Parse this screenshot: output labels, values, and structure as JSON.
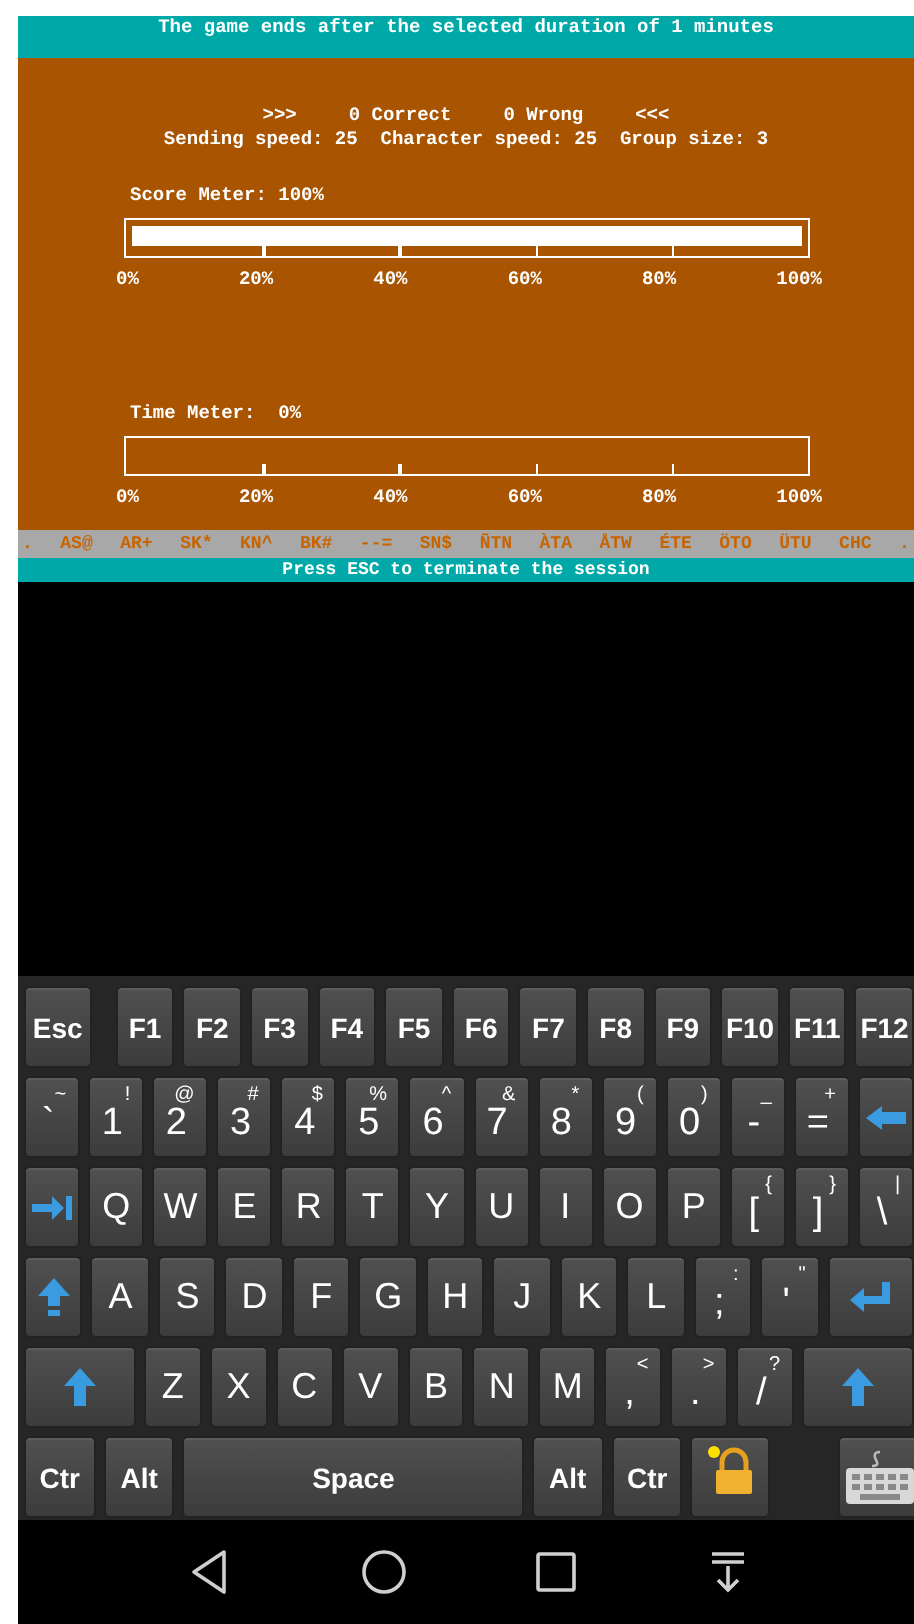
{
  "top_banner": {
    "text": "The game ends after the selected duration of 1 minutes"
  },
  "score_line": {
    "left_marker": ">>>",
    "correct": "0 Correct",
    "wrong": "0 Wrong",
    "right_marker": "<<<"
  },
  "settings_line": {
    "text": "Sending speed: 25  Character speed: 25  Group size: 3"
  },
  "meters": [
    {
      "label": "Score Meter: 100%",
      "level": 1,
      "tick_labels": [
        "0%",
        "20%",
        "40%",
        "60%",
        "80%",
        "100%"
      ]
    },
    {
      "label": "Time Meter:  0%",
      "level": 0,
      "tick_labels": [
        "0%",
        "20%",
        "40%",
        "60%",
        "80%",
        "100%"
      ]
    }
  ],
  "prosign_bar": {
    "items": [
      ".",
      "AS@",
      "AR+",
      "SK*",
      "KN^",
      "BK#",
      "--=",
      "SN$",
      "ÑTN",
      "ÀTA",
      "ÅTW",
      "ÉTE",
      "ÖTO",
      "ÜTU",
      "CHC",
      "."
    ]
  },
  "footer": {
    "text": "Press ESC to terminate the session"
  },
  "keyboard": {
    "rows": [
      {
        "keys": [
          {
            "kind": "fn",
            "label": "Esc"
          },
          {
            "kind": "fn",
            "label": "F1"
          },
          {
            "kind": "fn",
            "label": "F2"
          },
          {
            "kind": "fn",
            "label": "F3"
          },
          {
            "kind": "fn",
            "label": "F4"
          },
          {
            "kind": "fn",
            "label": "F5"
          },
          {
            "kind": "fn",
            "label": "F6"
          },
          {
            "kind": "fn",
            "label": "F7"
          },
          {
            "kind": "fn",
            "label": "F8"
          },
          {
            "kind": "fn",
            "label": "F9"
          },
          {
            "kind": "fn",
            "label": "F10"
          },
          {
            "kind": "fn",
            "label": "F11"
          },
          {
            "kind": "fn",
            "label": "F12"
          }
        ]
      },
      {
        "keys": [
          {
            "kind": "dual",
            "label": "`",
            "shift": "~"
          },
          {
            "kind": "dual",
            "label": "1",
            "shift": "!"
          },
          {
            "kind": "dual",
            "label": "2",
            "shift": "@"
          },
          {
            "kind": "dual",
            "label": "3",
            "shift": "#"
          },
          {
            "kind": "dual",
            "label": "4",
            "shift": "$"
          },
          {
            "kind": "dual",
            "label": "5",
            "shift": "%"
          },
          {
            "kind": "dual",
            "label": "6",
            "shift": "^"
          },
          {
            "kind": "dual",
            "label": "7",
            "shift": "&"
          },
          {
            "kind": "dual",
            "label": "8",
            "shift": "*"
          },
          {
            "kind": "dual",
            "label": "9",
            "shift": "("
          },
          {
            "kind": "dual",
            "label": "0",
            "shift": ")"
          },
          {
            "kind": "dual",
            "label": "-",
            "shift": "_"
          },
          {
            "kind": "dual",
            "label": "=",
            "shift": "+"
          },
          {
            "kind": "backspace"
          }
        ]
      },
      {
        "keys": [
          {
            "kind": "tab"
          },
          {
            "kind": "char",
            "label": "Q"
          },
          {
            "kind": "char",
            "label": "W"
          },
          {
            "kind": "char",
            "label": "E"
          },
          {
            "kind": "char",
            "label": "R"
          },
          {
            "kind": "char",
            "label": "T"
          },
          {
            "kind": "char",
            "label": "Y"
          },
          {
            "kind": "char",
            "label": "U"
          },
          {
            "kind": "char",
            "label": "I"
          },
          {
            "kind": "char",
            "label": "O"
          },
          {
            "kind": "char",
            "label": "P"
          },
          {
            "kind": "dual",
            "label": "[",
            "shift": "{"
          },
          {
            "kind": "dual",
            "label": "]",
            "shift": "}"
          },
          {
            "kind": "dual",
            "label": "\\",
            "shift": "|"
          }
        ]
      },
      {
        "keys": [
          {
            "kind": "capslock"
          },
          {
            "kind": "char",
            "label": "A"
          },
          {
            "kind": "char",
            "label": "S"
          },
          {
            "kind": "char",
            "label": "D"
          },
          {
            "kind": "char",
            "label": "F"
          },
          {
            "kind": "char",
            "label": "G"
          },
          {
            "kind": "char",
            "label": "H"
          },
          {
            "kind": "char",
            "label": "J"
          },
          {
            "kind": "char",
            "label": "K"
          },
          {
            "kind": "char",
            "label": "L"
          },
          {
            "kind": "dual",
            "label": ";",
            "shift": ":"
          },
          {
            "kind": "dual",
            "label": "'",
            "shift": "\""
          },
          {
            "kind": "enter"
          }
        ]
      },
      {
        "keys": [
          {
            "kind": "shift"
          },
          {
            "kind": "char",
            "label": "Z"
          },
          {
            "kind": "char",
            "label": "X"
          },
          {
            "kind": "char",
            "label": "C"
          },
          {
            "kind": "char",
            "label": "V"
          },
          {
            "kind": "char",
            "label": "B"
          },
          {
            "kind": "char",
            "label": "N"
          },
          {
            "kind": "char",
            "label": "M"
          },
          {
            "kind": "dual",
            "label": ",",
            "shift": "<"
          },
          {
            "kind": "dual",
            "label": ".",
            "shift": ">"
          },
          {
            "kind": "dual",
            "label": "/",
            "shift": "?"
          },
          {
            "kind": "shift"
          }
        ]
      },
      {
        "keys": [
          {
            "kind": "fn",
            "label": "Ctr"
          },
          {
            "kind": "fn",
            "label": "Alt"
          },
          {
            "kind": "space",
            "label": "Space"
          },
          {
            "kind": "fn",
            "label": "Alt"
          },
          {
            "kind": "fn",
            "label": "Ctr"
          },
          {
            "kind": "lock"
          },
          {
            "kind": "keyboard"
          }
        ]
      }
    ]
  }
}
